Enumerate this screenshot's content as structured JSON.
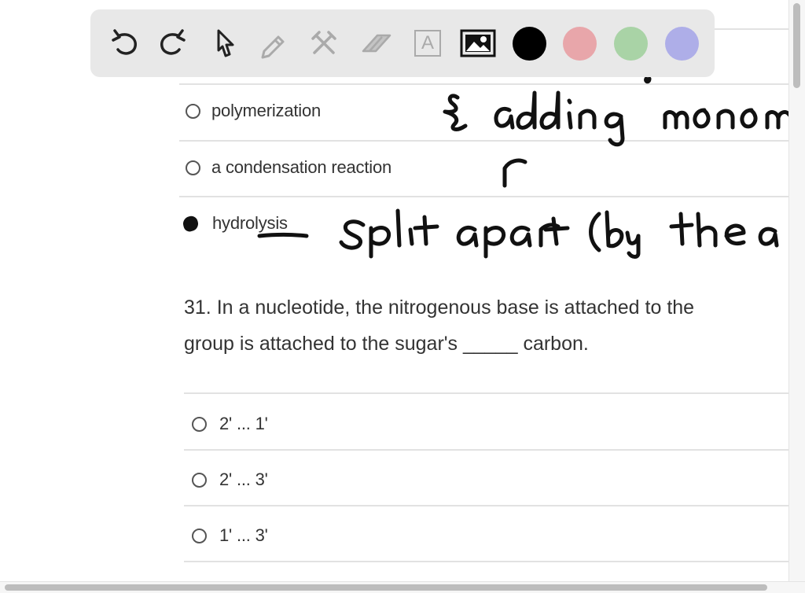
{
  "toolbar": {
    "tools": [
      {
        "name": "undo",
        "icon": "undo-icon"
      },
      {
        "name": "redo",
        "icon": "redo-icon"
      },
      {
        "name": "select",
        "icon": "cursor-icon"
      },
      {
        "name": "pen",
        "icon": "pen-icon"
      },
      {
        "name": "tools",
        "icon": "hammer-wrench-icon"
      },
      {
        "name": "eraser",
        "icon": "eraser-icon"
      },
      {
        "name": "text",
        "icon": "text-box-icon",
        "glyph": "A"
      },
      {
        "name": "image",
        "icon": "image-icon"
      }
    ],
    "colors": [
      "#000000",
      "#e8a6aa",
      "#a9d3a6",
      "#aeaee8"
    ]
  },
  "question_30": {
    "options": [
      {
        "label": "polymerization",
        "selected": false
      },
      {
        "label": "a condensation reaction",
        "selected": false
      },
      {
        "label": "hydrolysis",
        "selected": true
      }
    ]
  },
  "question_31": {
    "text_line1": "31. In a nucleotide, the nitrogenous base is attached to the",
    "text_line2": "group is attached to the sugar's _____ carbon.",
    "options": [
      {
        "label": "2' ... 1'",
        "selected": false
      },
      {
        "label": "2' ... 3'",
        "selected": false
      },
      {
        "label": "1' ... 3'",
        "selected": false
      }
    ]
  },
  "annotations": [
    "adding monom",
    "split apart (by the a"
  ]
}
